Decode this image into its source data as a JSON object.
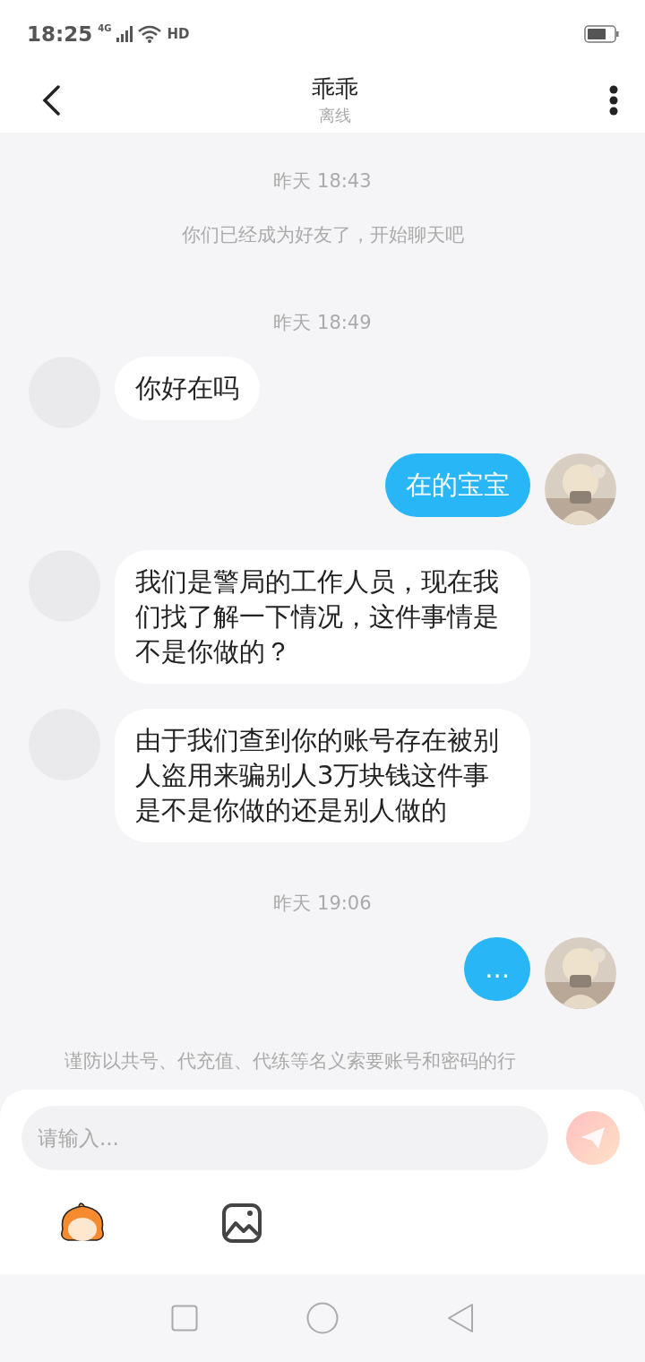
{
  "status_bar": {
    "time": "18:25",
    "network": "4G",
    "hd": "HD"
  },
  "header": {
    "title": "乖乖",
    "subtitle": "离线"
  },
  "messages": [
    {
      "kind": "time",
      "text": "昨天 18:43"
    },
    {
      "kind": "system",
      "text": "你们已经成为好友了，开始聊天吧"
    },
    {
      "kind": "time",
      "text": "昨天 18:49"
    },
    {
      "kind": "incoming",
      "text": "你好在吗"
    },
    {
      "kind": "outgoing",
      "text": "在的宝宝"
    },
    {
      "kind": "incoming",
      "text": "我们是警局的工作人员，现在我们找了解一下情况，这件事情是不是你做的？"
    },
    {
      "kind": "incoming",
      "text": "由于我们查到你的账号存在被别人盗用来骗别人3万块钱这件事是不是你做的还是别人做的"
    },
    {
      "kind": "time",
      "text": "昨天 19:06"
    },
    {
      "kind": "outgoing",
      "text": "..."
    }
  ],
  "notice": "谨防以共号、代充值、代练等名义索要账号和密码的行",
  "composer": {
    "placeholder": "请输入...",
    "send_disabled": true
  }
}
